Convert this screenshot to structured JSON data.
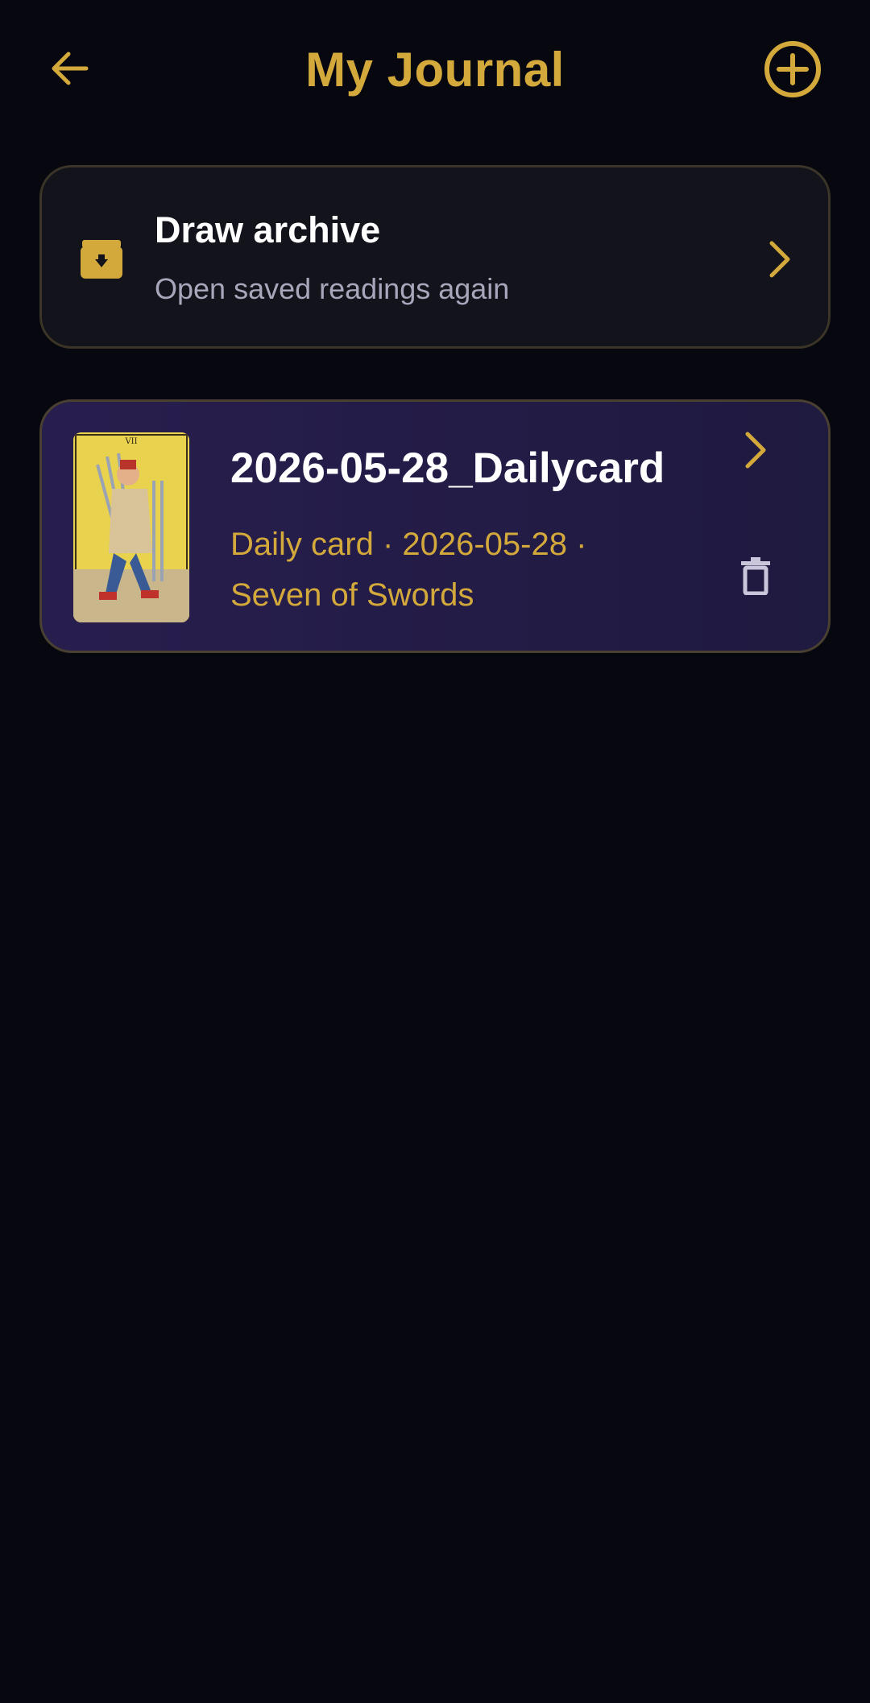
{
  "header": {
    "title": "My Journal",
    "back_icon": "arrow-left-icon",
    "add_icon": "plus-circle-icon"
  },
  "archive": {
    "title": "Draw archive",
    "subtitle": "Open saved readings again",
    "icon": "archive-box-icon",
    "chevron_icon": "chevron-right-icon"
  },
  "entries": [
    {
      "title": "2026-05-28_Dailycard",
      "meta_line1": "Daily card · 2026-05-28 ·",
      "meta_line2": "Seven of Swords",
      "card_numeral": "VII",
      "thumbnail_icon": "tarot-card-seven-of-swords",
      "chevron_icon": "chevron-right-icon",
      "delete_icon": "trash-icon"
    }
  ],
  "colors": {
    "background": "#070710",
    "accent_gold": "#d4a93c",
    "card_surface": "#13131c",
    "entry_surface": "#281e4e",
    "muted_text": "#a8a6ba",
    "icon_muted": "#c9c6dc"
  }
}
